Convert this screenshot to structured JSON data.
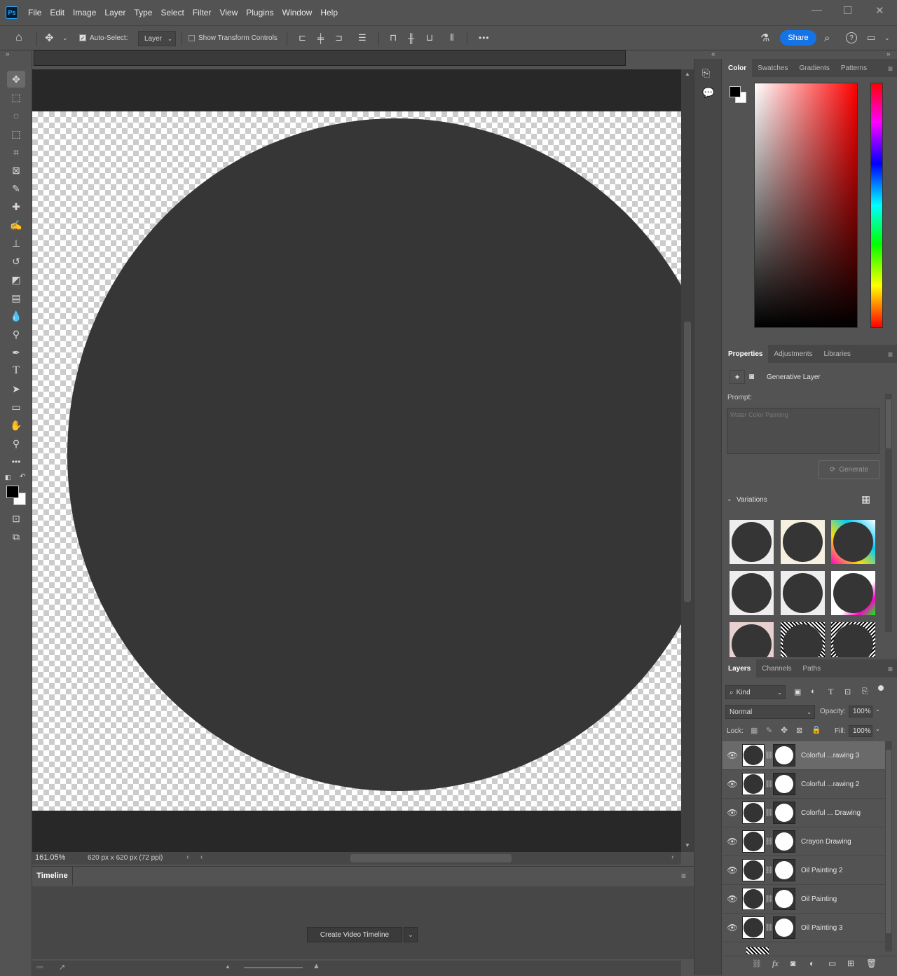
{
  "menubar": {
    "logo": "Ps",
    "items": [
      "File",
      "Edit",
      "Image",
      "Layer",
      "Type",
      "Select",
      "Filter",
      "View",
      "Plugins",
      "Window",
      "Help"
    ],
    "window_controls": {
      "minimize": "—",
      "maximize": "☐",
      "close": "✕"
    }
  },
  "options_bar": {
    "auto_select_label": "Auto-Select:",
    "auto_select_checked": true,
    "auto_select_target": "Layer",
    "show_transform_label": "Show Transform Controls",
    "show_transform_checked": false,
    "more": "•••",
    "share_label": "Share"
  },
  "status": {
    "zoom": "161.05%",
    "doc_info": "620 px x 620 px (72 ppi)"
  },
  "timeline": {
    "tab_label": "Timeline",
    "create_button": "Create Video Timeline"
  },
  "color_panel": {
    "tabs": [
      "Color",
      "Swatches",
      "Gradients",
      "Patterns"
    ],
    "active_tab": "Color",
    "foreground": "#000000",
    "background": "#ffffff",
    "hue": "#ff0000"
  },
  "properties_panel": {
    "tabs": [
      "Properties",
      "Adjustments",
      "Libraries"
    ],
    "active_tab": "Properties",
    "layer_type": "Generative Layer",
    "prompt_label": "Prompt:",
    "prompt_placeholder": "Water Color Painting",
    "generate_label": "Generate",
    "variations_label": "Variations"
  },
  "layers_panel": {
    "tabs": [
      "Layers",
      "Channels",
      "Paths"
    ],
    "active_tab": "Layers",
    "filter_kind": "Kind",
    "blend_mode": "Normal",
    "opacity_label": "Opacity:",
    "opacity": "100%",
    "lock_label": "Lock:",
    "fill_label": "Fill:",
    "fill": "100%",
    "layers": [
      {
        "name": "Colorful ...rawing 3",
        "selected": true
      },
      {
        "name": "Colorful ...rawing 2",
        "selected": false
      },
      {
        "name": "Colorful ... Drawing",
        "selected": false
      },
      {
        "name": "Crayon Drawing",
        "selected": false
      },
      {
        "name": "Oil Painting 2",
        "selected": false
      },
      {
        "name": "Oil Painting",
        "selected": false
      },
      {
        "name": "Oil Painting 3",
        "selected": false
      }
    ]
  }
}
